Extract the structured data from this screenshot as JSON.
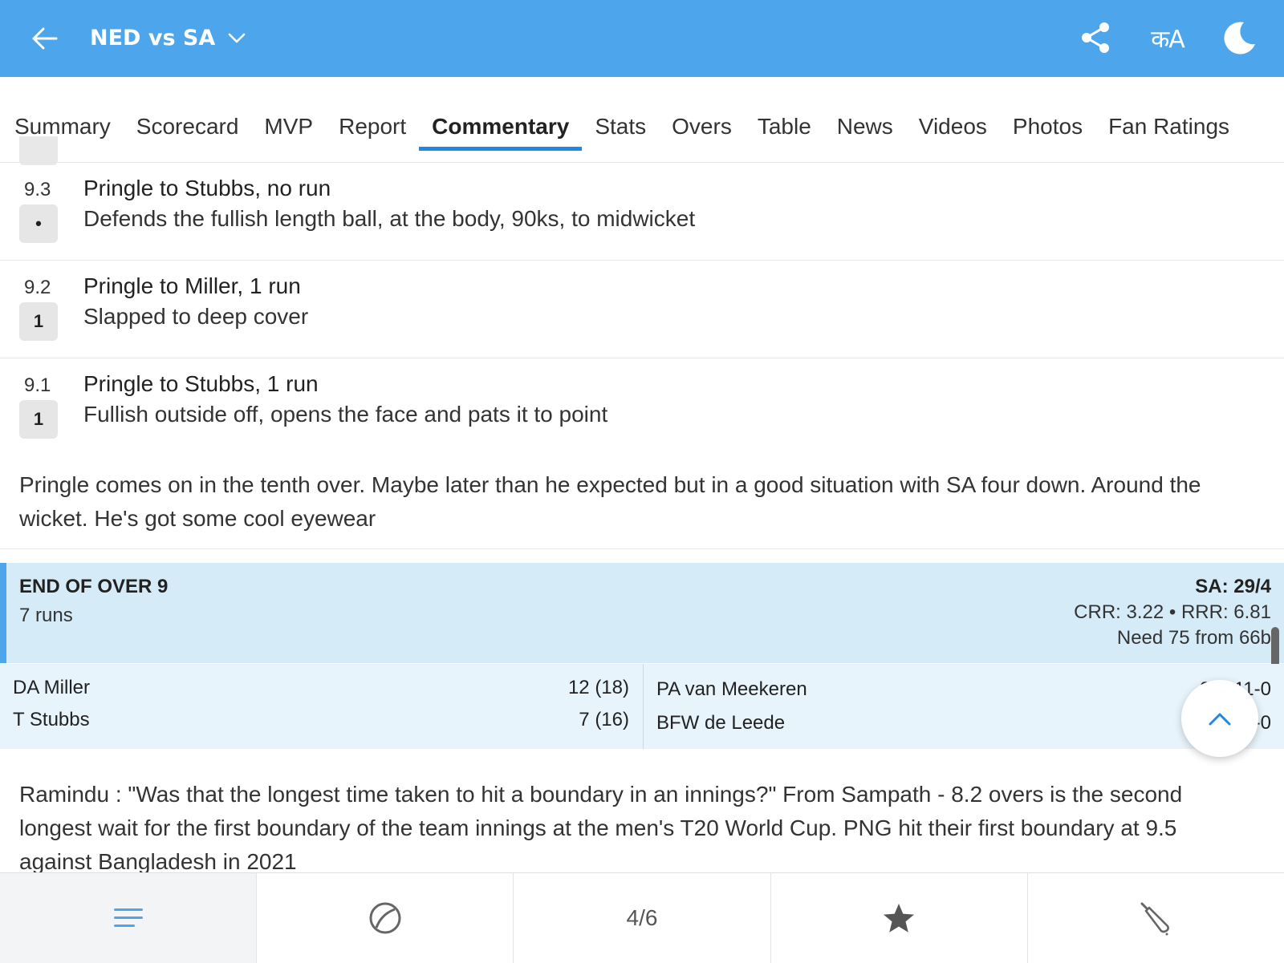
{
  "header": {
    "title": "NED vs SA",
    "language_label": "कA",
    "back_icon": "arrow-left-icon",
    "share_icon": "share-icon",
    "theme_icon": "moon-icon",
    "bg_color": "#4DA6EC"
  },
  "tabs": [
    {
      "label": "Summary"
    },
    {
      "label": "Scorecard"
    },
    {
      "label": "MVP"
    },
    {
      "label": "Report"
    },
    {
      "label": "Commentary",
      "active": true
    },
    {
      "label": "Stats"
    },
    {
      "label": "Overs"
    },
    {
      "label": "Table"
    },
    {
      "label": "News"
    },
    {
      "label": "Videos"
    },
    {
      "label": "Photos"
    },
    {
      "label": "Fan Ratings"
    }
  ],
  "commentary": [
    {
      "over": "9.3",
      "badge": "•",
      "title": "Pringle to Stubbs, no run",
      "text": "Defends the fullish length ball, at the body, 90ks, to midwicket"
    },
    {
      "over": "9.2",
      "badge": "1",
      "title": "Pringle to Miller, 1 run",
      "text": "Slapped to deep cover"
    },
    {
      "over": "9.1",
      "badge": "1",
      "title": "Pringle to Stubbs, 1 run",
      "text": "Fullish outside off, opens the face and pats it to point"
    }
  ],
  "note": "Pringle comes on in the tenth over. Maybe later than he expected but in a good situation with SA four down. Around the wicket. He's got some cool eyewear",
  "end_of_over": {
    "heading": "END OF OVER 9",
    "runs": "7 runs",
    "score": "SA: 29/4",
    "rates": "CRR: 3.22 • RRR: 6.81",
    "need": "Need 75 from 66b"
  },
  "batters": [
    {
      "name": "DA Miller",
      "score": "12 (18)"
    },
    {
      "name": "T Stubbs",
      "score": "7 (16)"
    }
  ],
  "bowlers": [
    {
      "name": "PA van Meekeren",
      "figures": "2-0-11-0"
    },
    {
      "name": "BFW de Leede",
      "figures": "1-0-2-0"
    }
  ],
  "comment2": "Ramindu : \"Was that the longest time taken to hit a boundary in an innings?\" From Sampath - 8.2 overs is the second longest wait for the first boundary of the team innings at the men's T20 World Cup. PNG hit their first boundary at 9.5 against Bangladesh in 2021",
  "bottom_nav": {
    "menu_icon": "menu-lines-icon",
    "ball_icon": "cricket-ball-icon",
    "page_indicator": "4/6",
    "star_icon": "star-icon",
    "bat_icon": "cricket-bat-icon"
  },
  "accent_color": "#1E88E5"
}
